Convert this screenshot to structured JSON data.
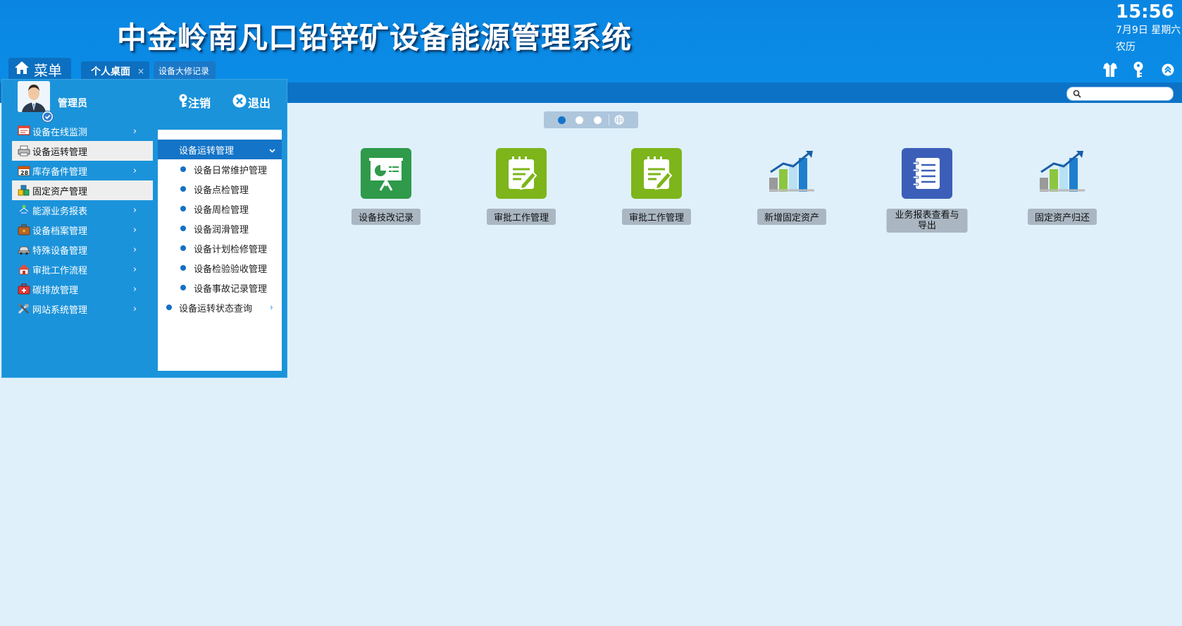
{
  "header": {
    "title": "中金岭南凡口铅锌矿设备能源管理系统",
    "time": "15:56",
    "date": "7月9日 星期六",
    "lunar": "农历",
    "menu_label": "菜单",
    "tabs": [
      {
        "label": "个人桌面",
        "close": "×"
      },
      {
        "label": "设备大修记录"
      }
    ],
    "right_icons": [
      "shirt-icon",
      "key-icon",
      "collapse-up-icon"
    ]
  },
  "search": {
    "placeholder": ""
  },
  "pager": {
    "pages": 3,
    "active": 1
  },
  "desktop_apps": [
    {
      "label": "设备技改记录",
      "icon": "presentation-icon",
      "color": "#2e9a4a"
    },
    {
      "label": "审批工作管理",
      "icon": "notepad-edit-icon",
      "color": "#7db51b"
    },
    {
      "label": "审批工作管理",
      "icon": "notepad-edit-icon",
      "color": "#7db51b"
    },
    {
      "label": "新增固定资产",
      "icon": "bar-chart-icon"
    },
    {
      "label": "业务报表查看与导出",
      "icon": "notebook-list-icon",
      "color": "#3b5fb8"
    },
    {
      "label": "固定资产归还",
      "icon": "bar-chart-icon"
    }
  ],
  "menu": {
    "user": "管理员",
    "logout": "注销",
    "exit": "退出",
    "items": [
      {
        "label": "设备在线监测",
        "icon": "monitor-icon",
        "has_arrow": true,
        "active": false
      },
      {
        "label": "设备运转管理",
        "icon": "printer-icon",
        "has_arrow": false,
        "active": true
      },
      {
        "label": "库存备件管理",
        "icon": "calendar-icon",
        "has_arrow": true,
        "active": false
      },
      {
        "label": "固定资产管理",
        "icon": "blocks-icon",
        "has_arrow": false,
        "active": true
      },
      {
        "label": "能源业务报表",
        "icon": "network-icon",
        "has_arrow": true,
        "active": false
      },
      {
        "label": "设备档案管理",
        "icon": "briefcase-icon",
        "has_arrow": true,
        "active": false
      },
      {
        "label": "特殊设备管理",
        "icon": "car-icon",
        "has_arrow": true,
        "active": false
      },
      {
        "label": "审批工作流程",
        "icon": "house-icon",
        "has_arrow": true,
        "active": false
      },
      {
        "label": "碳排放管理",
        "icon": "medkit-icon",
        "has_arrow": true,
        "active": false
      },
      {
        "label": "网站系统管理",
        "icon": "tools-icon",
        "has_arrow": true,
        "active": false
      }
    ],
    "arrow": "›"
  },
  "submenu": {
    "header": "设备运转管理",
    "items": [
      "设备日常维护管理",
      "设备点检管理",
      "设备周检管理",
      "设备润滑管理",
      "设备计划检修管理",
      "设备检验验收管理",
      "设备事故记录管理"
    ],
    "extra": "设备运转状态查询"
  },
  "colors": {
    "header_bg": "#0a8ce6",
    "panel_bg": "#1b93da",
    "subbar_bg": "#0c72c6",
    "desktop_bg": "#dff0fb",
    "accent": "#1474c8"
  }
}
